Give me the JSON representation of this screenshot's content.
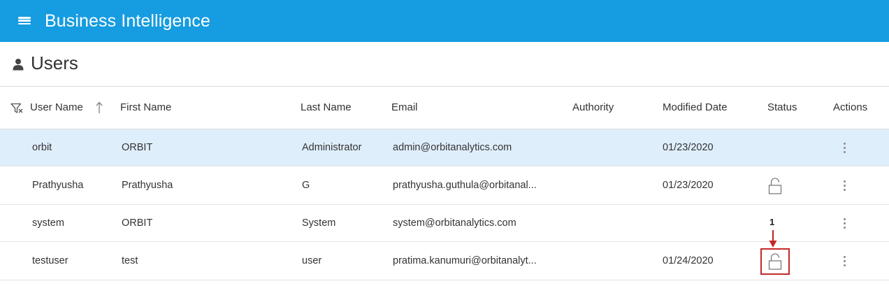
{
  "app": {
    "title": "Business Intelligence"
  },
  "page": {
    "title": "Users"
  },
  "table": {
    "columns": [
      "User Name",
      "First Name",
      "Last Name",
      "Email",
      "Authority",
      "Modified Date",
      "Status",
      "Actions"
    ],
    "rows": [
      {
        "username": "orbit",
        "first_name": "ORBIT",
        "last_name": "Administrator",
        "email": "admin@orbitanalytics.com",
        "authority": "",
        "modified": "01/23/2020",
        "status": "none",
        "selected": true
      },
      {
        "username": "Prathyusha",
        "first_name": "Prathyusha",
        "last_name": "G",
        "email": "prathyusha.guthula@orbitanal...",
        "authority": "",
        "modified": "01/23/2020",
        "status": "unlocked",
        "selected": false
      },
      {
        "username": "system",
        "first_name": "ORBIT",
        "last_name": "System",
        "email": "system@orbitanalytics.com",
        "authority": "",
        "modified": "",
        "status": "none",
        "selected": false
      },
      {
        "username": "testuser",
        "first_name": "test",
        "last_name": "user",
        "email": "pratima.kanumuri@orbitanalyt...",
        "authority": "",
        "modified": "01/24/2020",
        "status": "unlocked",
        "selected": false
      }
    ]
  },
  "annotation": {
    "label": "1"
  },
  "colors": {
    "appbar": "#169ce0",
    "selected_row": "#dfeefb",
    "annotation": "#c62828"
  },
  "icons": {
    "menu": "hamburger-menu-icon",
    "user": "user-icon",
    "filter": "filter-icon",
    "sort": "sort-ascending-icon",
    "lock": "unlock-icon",
    "actions": "more-vertical-icon"
  }
}
